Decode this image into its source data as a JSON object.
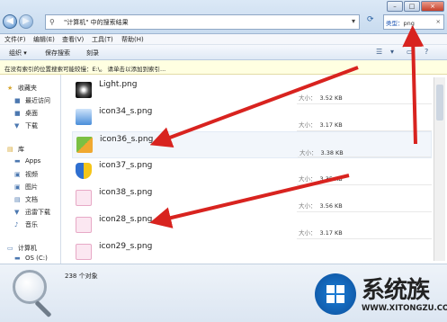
{
  "address": {
    "path": "\"计算机\" 中的搜索结果",
    "chevron": "▸"
  },
  "search": {
    "label": "类型：",
    "value": "png",
    "clear": "×"
  },
  "window_buttons": {
    "min": "–",
    "max": "□",
    "close": "×"
  },
  "menu": [
    "文件(F)",
    "编辑(E)",
    "查看(V)",
    "工具(T)",
    "帮助(H)"
  ],
  "toolbar": {
    "organize": "组织 ▾",
    "save_search": "保存搜索",
    "burn": "刻录"
  },
  "infobar": "在没有索引的位置搜索可能较慢：E:\\。 请单击以添加到索引...",
  "sidebar": {
    "favorites": "收藏夹",
    "recent": "最近访问",
    "desktop": "桌面",
    "downloads": "下载",
    "libraries": "库",
    "apps": "Apps",
    "videos": "视频",
    "pictures": "图片",
    "documents": "文档",
    "xunlei": "迅雷下载",
    "music": "音乐",
    "computer": "计算机",
    "os_drive": "OS (C:)"
  },
  "size_label": "大小：",
  "files": [
    {
      "name": "Light.png",
      "size": "3.52 KB"
    },
    {
      "name": "icon34_s.png",
      "size": "3.17 KB"
    },
    {
      "name": "icon36_s.png",
      "size": "3.38 KB"
    },
    {
      "name": "icon37_s.png",
      "size": "3.35 KB"
    },
    {
      "name": "icon38_s.png",
      "size": "3.56 KB"
    },
    {
      "name": "icon28_s.png",
      "size": "3.17 KB"
    },
    {
      "name": "icon29_s.png",
      "size": ""
    }
  ],
  "status": {
    "count": "238 个对象"
  },
  "watermark": {
    "brand": "系统族",
    "url": "WWW.XITONGZU.COM"
  },
  "colors": {
    "arrow": "#d8231f",
    "accent": "#2b62a4"
  }
}
